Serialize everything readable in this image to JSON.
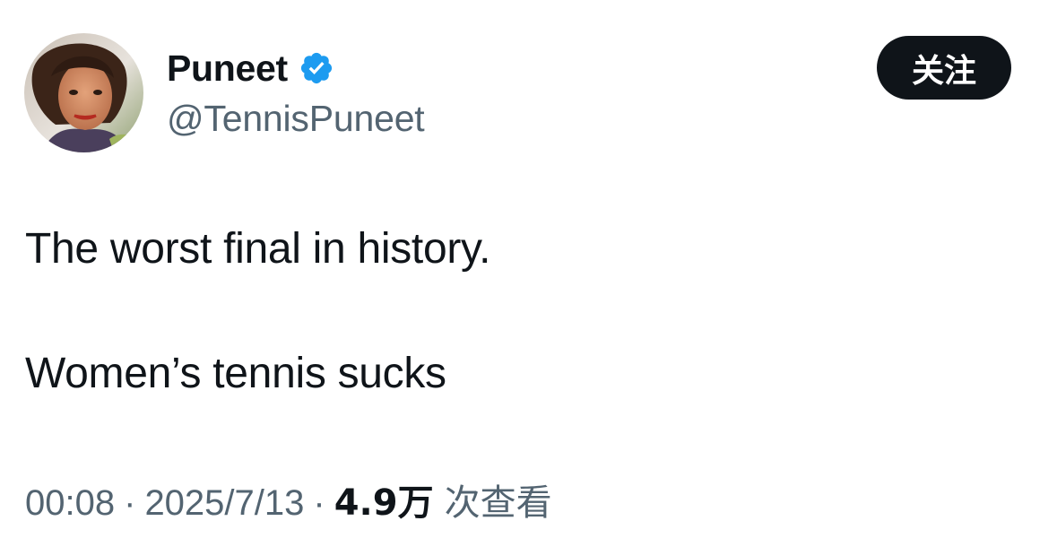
{
  "author": {
    "display_name": "Puneet",
    "handle": "@TennisPuneet",
    "verified_icon": "verified-badge-icon",
    "verified_color": "#1d9bf0"
  },
  "follow_button": {
    "label": "关注"
  },
  "tweet": {
    "line_1": "The worst final in history.",
    "line_2": "Women’s tennis sucks"
  },
  "meta": {
    "time": "00:08",
    "separator": "·",
    "date": "2025/7/13",
    "views_count": "4.9万",
    "views_label": "次查看"
  },
  "colors": {
    "text_primary": "#0f1419",
    "text_secondary": "#536471",
    "button_bg": "#0f1419",
    "button_text": "#ffffff"
  }
}
